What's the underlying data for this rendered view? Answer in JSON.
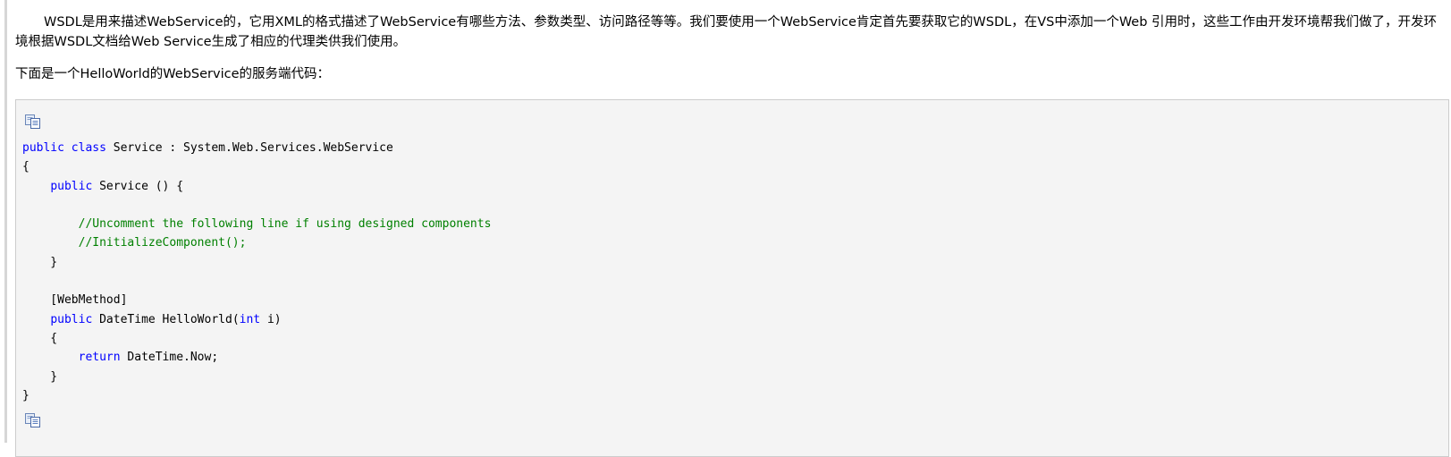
{
  "article": {
    "paragraph_1": "WSDL是用来描述WebService的，它用XML的格式描述了WebService有哪些方法、参数类型、访问路径等等。我们要使用一个WebService肯定首先要获取它的WSDL，在VS中添加一个Web 引用时，这些工作由开发环境帮我们做了，开发环境根据WSDL文档给Web Service生成了相应的代理类供我们使用。",
    "paragraph_2": "下面是一个HelloWorld的WebService的服务端代码："
  },
  "code_block": {
    "copy_icon_top": "copy-icon",
    "copy_icon_bottom": "copy-icon",
    "lines": [
      [
        {
          "t": "kw",
          "v": "public"
        },
        {
          "t": "p",
          "v": " "
        },
        {
          "t": "kw",
          "v": "class"
        },
        {
          "t": "p",
          "v": " Service : System.Web.Services.WebService"
        }
      ],
      [
        {
          "t": "p",
          "v": "{"
        }
      ],
      [
        {
          "t": "p",
          "v": "    "
        },
        {
          "t": "kw",
          "v": "public"
        },
        {
          "t": "p",
          "v": " Service () {"
        }
      ],
      [
        {
          "t": "p",
          "v": ""
        }
      ],
      [
        {
          "t": "p",
          "v": "        "
        },
        {
          "t": "cm",
          "v": "//Uncomment the following line if using designed components"
        }
      ],
      [
        {
          "t": "p",
          "v": "        "
        },
        {
          "t": "cm",
          "v": "//InitializeComponent();"
        }
      ],
      [
        {
          "t": "p",
          "v": "    }"
        }
      ],
      [
        {
          "t": "p",
          "v": ""
        }
      ],
      [
        {
          "t": "p",
          "v": "    [WebMethod]"
        }
      ],
      [
        {
          "t": "p",
          "v": "    "
        },
        {
          "t": "kw",
          "v": "public"
        },
        {
          "t": "p",
          "v": " DateTime HelloWorld("
        },
        {
          "t": "kw",
          "v": "int"
        },
        {
          "t": "p",
          "v": " i)"
        }
      ],
      [
        {
          "t": "p",
          "v": "    {"
        }
      ],
      [
        {
          "t": "p",
          "v": "        "
        },
        {
          "t": "kw",
          "v": "return"
        },
        {
          "t": "p",
          "v": " DateTime.Now;"
        }
      ],
      [
        {
          "t": "p",
          "v": "    }"
        }
      ],
      [
        {
          "t": "p",
          "v": "}"
        }
      ]
    ]
  },
  "colors": {
    "keyword": "#0000ff",
    "comment": "#008000",
    "code_background": "#f4f4f4",
    "code_border": "#cccccc"
  }
}
